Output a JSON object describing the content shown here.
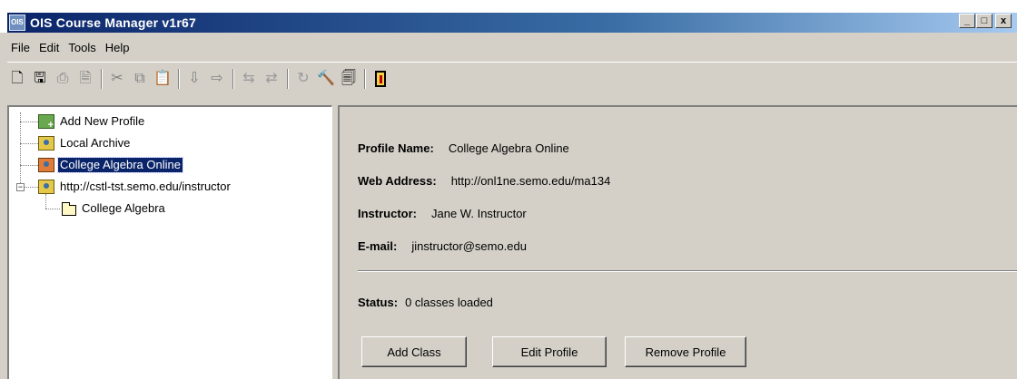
{
  "window": {
    "title": "OIS Course Manager v1r67",
    "icon_label": "OIS",
    "minimize_glyph": "_",
    "maximize_glyph": "□",
    "close_glyph": "x"
  },
  "menu": [
    {
      "label": "File"
    },
    {
      "label": "Edit"
    },
    {
      "label": "Tools"
    },
    {
      "label": "Help"
    }
  ],
  "toolbar": {
    "icons": [
      "new-icon",
      "save-icon",
      "print-icon",
      "print-preview-icon",
      "cut-icon",
      "copy-icon",
      "paste-icon",
      "import-icon",
      "export-icon",
      "disconnect-icon",
      "connect-icon",
      "refresh-icon",
      "tools-icon",
      "upload-icon",
      "exit-door-icon"
    ],
    "glyphs": {
      "new": "🗋",
      "save": "🖫",
      "print": "⎙",
      "preview": "🗎",
      "cut": "✂",
      "copy": "⧉",
      "paste": "📋",
      "import": "⇩",
      "export": "⇨",
      "disconnect": "⇆",
      "connect": "⇄",
      "refresh": "↻",
      "tools": "🔨",
      "upload": "🗐"
    }
  },
  "tree": {
    "nodes": [
      {
        "label": "Add New Profile",
        "icon": "add-profile-icon"
      },
      {
        "label": "Local Archive",
        "icon": "profile-icon"
      },
      {
        "label": "College Algebra Online",
        "icon": "profile-icon",
        "selected": true
      },
      {
        "label": "http://cstl-tst.semo.edu/instructor",
        "icon": "profile-icon",
        "expanded": true
      },
      {
        "label": "College Algebra",
        "icon": "folder-icon"
      }
    ],
    "expander_glyph": "−"
  },
  "details": {
    "profile_name_label": "Profile Name:",
    "profile_name": "College Algebra Online",
    "web_address_label": "Web Address:",
    "web_address": "http://onl1ne.semo.edu/ma134",
    "instructor_label": "Instructor:",
    "instructor": "Jane W. Instructor",
    "email_label": "E-mail:",
    "email": "jinstructor@semo.edu",
    "status_label": "Status:",
    "status": "0 classes loaded"
  },
  "buttons": {
    "add_class": "Add Class",
    "edit_profile": "Edit Profile",
    "remove_profile": "Remove Profile"
  }
}
